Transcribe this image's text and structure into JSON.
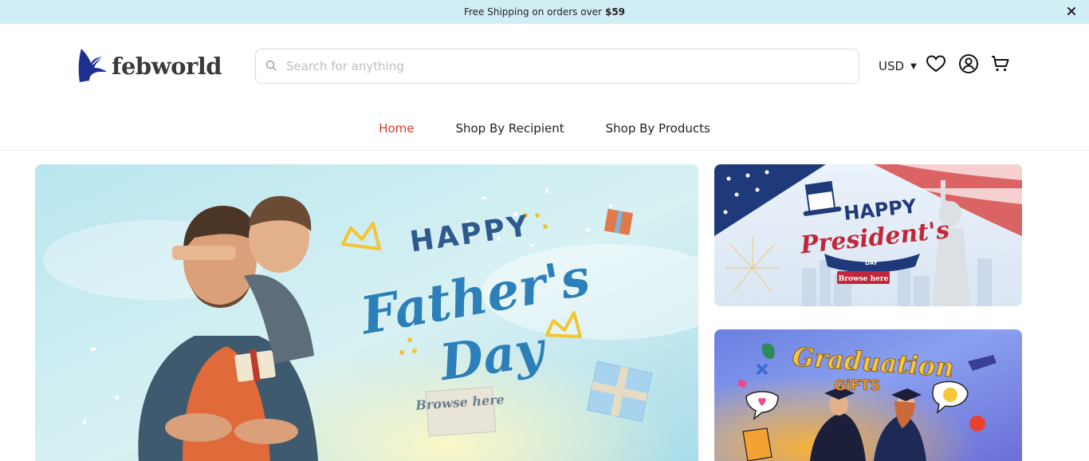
{
  "announcement": {
    "text": "Free Shipping on orders over",
    "amount": "$59"
  },
  "brand": {
    "name": "febworld",
    "color": "#1f2f8f"
  },
  "search": {
    "placeholder": "Search for anything"
  },
  "header": {
    "currency": "USD",
    "icons": [
      "heart-icon",
      "account-icon",
      "cart-icon"
    ]
  },
  "nav": {
    "items": [
      {
        "label": "Home",
        "active": true
      },
      {
        "label": "Shop By Recipient",
        "active": false
      },
      {
        "label": "Shop By Products",
        "active": false
      }
    ],
    "active_color": "#d93a2b"
  },
  "banners": {
    "fathers_day": {
      "line1": "HAPPY",
      "line2": "Father's",
      "line3": "Day",
      "cta": "Browse here"
    },
    "presidents_day": {
      "line1": "HAPPY",
      "line2": "President's",
      "line3": "DAY",
      "cta": "Browse here"
    },
    "graduation": {
      "line1": "Graduation",
      "line2": "GiFTS"
    }
  }
}
